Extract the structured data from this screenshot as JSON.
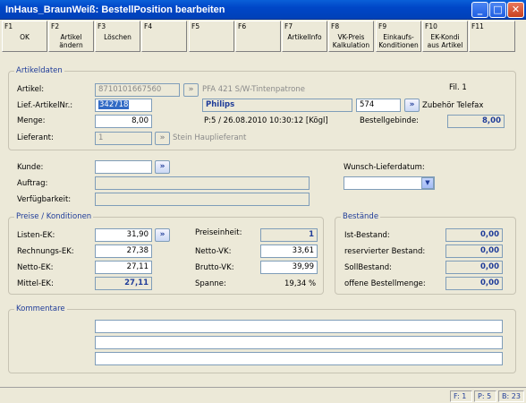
{
  "window": {
    "title": "InHaus_BraunWeiß: BestellPosition bearbeiten",
    "buttons": [
      "_",
      "□",
      "✕"
    ]
  },
  "fkeys": [
    {
      "n": "F1",
      "label": "OK"
    },
    {
      "n": "F2",
      "label": "Artikel\nändern"
    },
    {
      "n": "F3",
      "label": "Löschen"
    },
    {
      "n": "F4",
      "label": ""
    },
    {
      "n": "F5",
      "label": ""
    },
    {
      "n": "F6",
      "label": ""
    },
    {
      "n": "F7",
      "label": "ArtikelInfo"
    },
    {
      "n": "F8",
      "label": "VK-Preis\nKalkulation"
    },
    {
      "n": "F9",
      "label": "Einkaufs-\nKonditionen"
    },
    {
      "n": "F10",
      "label": "EK-Kondi\naus Artikel"
    },
    {
      "n": "F11",
      "label": ""
    }
  ],
  "artikeldaten": {
    "legend": "Artikeldaten",
    "artikel_label": "Artikel:",
    "artikel_value": "8710101667560",
    "artikel_desc": "PFA 421 S/W-Tintenpatrone",
    "fil_label": "Fil. 1",
    "lief_label": "Lief.-ArtikelNr.:",
    "lief_value": "342718",
    "brand": "Philips",
    "code": "574",
    "code_desc": "Zubehör Telefax",
    "menge_label": "Menge:",
    "menge_value": "8,00",
    "pos_info": "P:5 / 26.08.2010 10:30:12 [Kögl]",
    "gebinde_label": "Bestellgebinde:",
    "gebinde_value": "8,00",
    "lieferant_label": "Lieferant:",
    "lieferant_value": "1",
    "lieferant_desc": "Stein Hauplieferant"
  },
  "kunde": {
    "kunde_label": "Kunde:",
    "kunde_value": "",
    "auftrag_label": "Auftrag:",
    "auftrag_value": "",
    "verf_label": "Verfügbarkeit:",
    "verf_value": "",
    "wunsch_label": "Wunsch-Lieferdatum:",
    "wunsch_value": ""
  },
  "preise": {
    "legend": "Preise / Konditionen",
    "listen_label": "Listen-EK:",
    "listen_value": "31,90",
    "rechnungs_label": "Rechnungs-EK:",
    "rechnungs_value": "27,38",
    "netto_ek_label": "Netto-EK:",
    "netto_ek_value": "27,11",
    "mittel_label": "Mittel-EK:",
    "mittel_value": "27,11",
    "preiseinheit_label": "Preiseinheit:",
    "preiseinheit_value": "1",
    "netto_vk_label": "Netto-VK:",
    "netto_vk_value": "33,61",
    "brutto_vk_label": "Brutto-VK:",
    "brutto_vk_value": "39,99",
    "spanne_label": "Spanne:",
    "spanne_value": "19,34 %"
  },
  "bestaende": {
    "legend": "Bestände",
    "ist_label": "Ist-Bestand:",
    "ist_value": "0,00",
    "res_label": "reservierter Bestand:",
    "res_value": "0,00",
    "soll_label": "SollBestand:",
    "soll_value": "0,00",
    "offen_label": "offene Bestellmenge:",
    "offen_value": "0,00"
  },
  "kommentare": {
    "legend": "Kommentare",
    "lines": [
      "",
      "",
      ""
    ]
  },
  "status": {
    "f": "F: 1",
    "p": "P: 5",
    "b": "B: 23"
  }
}
